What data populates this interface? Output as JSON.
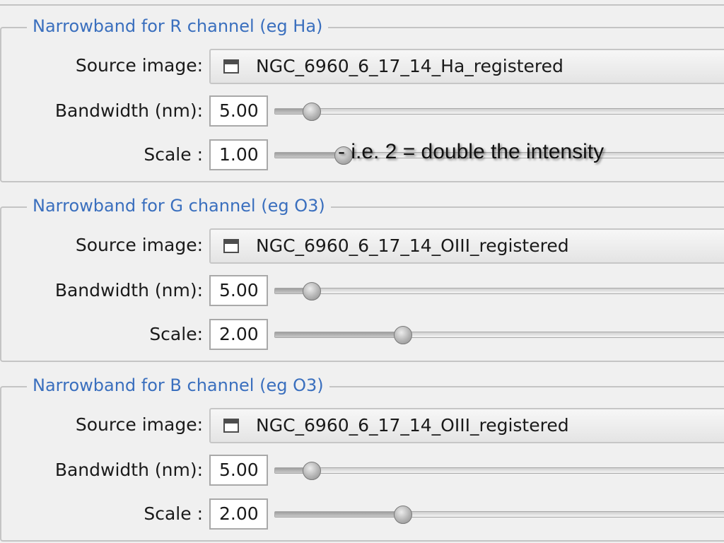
{
  "groups": [
    {
      "title": "Narrowband for R channel (eg Ha)",
      "source_label": "Source image:",
      "source_value": "NGC_6960_6_17_14_Ha_registered",
      "bandwidth_label": "Bandwidth (nm):",
      "bandwidth_value": "5.00",
      "bandwidth_slider_fraction": 0.08,
      "scale_label": "Scale :",
      "scale_value": "1.00",
      "scale_slider_fraction": 0.15
    },
    {
      "title": "Narrowband for G channel (eg O3)",
      "source_label": "Source image:",
      "source_value": "NGC_6960_6_17_14_OIII_registered",
      "bandwidth_label": "Bandwidth (nm):",
      "bandwidth_value": "5.00",
      "bandwidth_slider_fraction": 0.08,
      "scale_label": "Scale:",
      "scale_value": "2.00",
      "scale_slider_fraction": 0.28
    },
    {
      "title": "Narrowband for B channel (eg O3)",
      "source_label": "Source image:",
      "source_value": "NGC_6960_6_17_14_OIII_registered",
      "bandwidth_label": "Bandwidth (nm):",
      "bandwidth_value": "5.00",
      "bandwidth_slider_fraction": 0.08,
      "scale_label": "Scale :",
      "scale_value": "2.00",
      "scale_slider_fraction": 0.28
    }
  ],
  "annotation": "- i.e. 2 = double the intensity",
  "icons": {
    "source": "image-icon"
  },
  "colors": {
    "group_title": "#3a6fbe",
    "background": "#f0f0f0"
  }
}
